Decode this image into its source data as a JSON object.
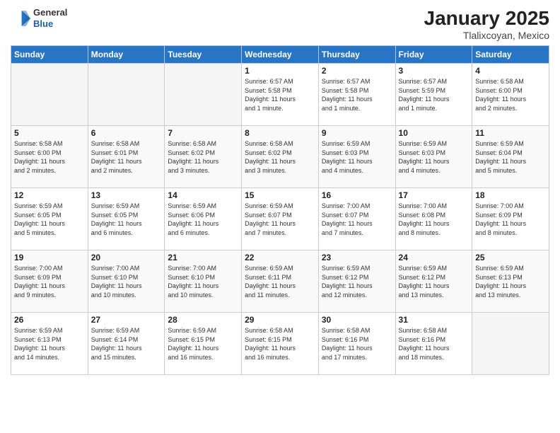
{
  "header": {
    "logo_general": "General",
    "logo_blue": "Blue",
    "month_title": "January 2025",
    "location": "Tlalixcoyan, Mexico"
  },
  "days_of_week": [
    "Sunday",
    "Monday",
    "Tuesday",
    "Wednesday",
    "Thursday",
    "Friday",
    "Saturday"
  ],
  "weeks": [
    [
      {
        "day": "",
        "info": ""
      },
      {
        "day": "",
        "info": ""
      },
      {
        "day": "",
        "info": ""
      },
      {
        "day": "1",
        "info": "Sunrise: 6:57 AM\nSunset: 5:58 PM\nDaylight: 11 hours\nand 1 minute."
      },
      {
        "day": "2",
        "info": "Sunrise: 6:57 AM\nSunset: 5:58 PM\nDaylight: 11 hours\nand 1 minute."
      },
      {
        "day": "3",
        "info": "Sunrise: 6:57 AM\nSunset: 5:59 PM\nDaylight: 11 hours\nand 1 minute."
      },
      {
        "day": "4",
        "info": "Sunrise: 6:58 AM\nSunset: 6:00 PM\nDaylight: 11 hours\nand 2 minutes."
      }
    ],
    [
      {
        "day": "5",
        "info": "Sunrise: 6:58 AM\nSunset: 6:00 PM\nDaylight: 11 hours\nand 2 minutes."
      },
      {
        "day": "6",
        "info": "Sunrise: 6:58 AM\nSunset: 6:01 PM\nDaylight: 11 hours\nand 2 minutes."
      },
      {
        "day": "7",
        "info": "Sunrise: 6:58 AM\nSunset: 6:02 PM\nDaylight: 11 hours\nand 3 minutes."
      },
      {
        "day": "8",
        "info": "Sunrise: 6:58 AM\nSunset: 6:02 PM\nDaylight: 11 hours\nand 3 minutes."
      },
      {
        "day": "9",
        "info": "Sunrise: 6:59 AM\nSunset: 6:03 PM\nDaylight: 11 hours\nand 4 minutes."
      },
      {
        "day": "10",
        "info": "Sunrise: 6:59 AM\nSunset: 6:03 PM\nDaylight: 11 hours\nand 4 minutes."
      },
      {
        "day": "11",
        "info": "Sunrise: 6:59 AM\nSunset: 6:04 PM\nDaylight: 11 hours\nand 5 minutes."
      }
    ],
    [
      {
        "day": "12",
        "info": "Sunrise: 6:59 AM\nSunset: 6:05 PM\nDaylight: 11 hours\nand 5 minutes."
      },
      {
        "day": "13",
        "info": "Sunrise: 6:59 AM\nSunset: 6:05 PM\nDaylight: 11 hours\nand 6 minutes."
      },
      {
        "day": "14",
        "info": "Sunrise: 6:59 AM\nSunset: 6:06 PM\nDaylight: 11 hours\nand 6 minutes."
      },
      {
        "day": "15",
        "info": "Sunrise: 6:59 AM\nSunset: 6:07 PM\nDaylight: 11 hours\nand 7 minutes."
      },
      {
        "day": "16",
        "info": "Sunrise: 7:00 AM\nSunset: 6:07 PM\nDaylight: 11 hours\nand 7 minutes."
      },
      {
        "day": "17",
        "info": "Sunrise: 7:00 AM\nSunset: 6:08 PM\nDaylight: 11 hours\nand 8 minutes."
      },
      {
        "day": "18",
        "info": "Sunrise: 7:00 AM\nSunset: 6:09 PM\nDaylight: 11 hours\nand 8 minutes."
      }
    ],
    [
      {
        "day": "19",
        "info": "Sunrise: 7:00 AM\nSunset: 6:09 PM\nDaylight: 11 hours\nand 9 minutes."
      },
      {
        "day": "20",
        "info": "Sunrise: 7:00 AM\nSunset: 6:10 PM\nDaylight: 11 hours\nand 10 minutes."
      },
      {
        "day": "21",
        "info": "Sunrise: 7:00 AM\nSunset: 6:10 PM\nDaylight: 11 hours\nand 10 minutes."
      },
      {
        "day": "22",
        "info": "Sunrise: 6:59 AM\nSunset: 6:11 PM\nDaylight: 11 hours\nand 11 minutes."
      },
      {
        "day": "23",
        "info": "Sunrise: 6:59 AM\nSunset: 6:12 PM\nDaylight: 11 hours\nand 12 minutes."
      },
      {
        "day": "24",
        "info": "Sunrise: 6:59 AM\nSunset: 6:12 PM\nDaylight: 11 hours\nand 13 minutes."
      },
      {
        "day": "25",
        "info": "Sunrise: 6:59 AM\nSunset: 6:13 PM\nDaylight: 11 hours\nand 13 minutes."
      }
    ],
    [
      {
        "day": "26",
        "info": "Sunrise: 6:59 AM\nSunset: 6:13 PM\nDaylight: 11 hours\nand 14 minutes."
      },
      {
        "day": "27",
        "info": "Sunrise: 6:59 AM\nSunset: 6:14 PM\nDaylight: 11 hours\nand 15 minutes."
      },
      {
        "day": "28",
        "info": "Sunrise: 6:59 AM\nSunset: 6:15 PM\nDaylight: 11 hours\nand 16 minutes."
      },
      {
        "day": "29",
        "info": "Sunrise: 6:58 AM\nSunset: 6:15 PM\nDaylight: 11 hours\nand 16 minutes."
      },
      {
        "day": "30",
        "info": "Sunrise: 6:58 AM\nSunset: 6:16 PM\nDaylight: 11 hours\nand 17 minutes."
      },
      {
        "day": "31",
        "info": "Sunrise: 6:58 AM\nSunset: 6:16 PM\nDaylight: 11 hours\nand 18 minutes."
      },
      {
        "day": "",
        "info": ""
      }
    ]
  ]
}
